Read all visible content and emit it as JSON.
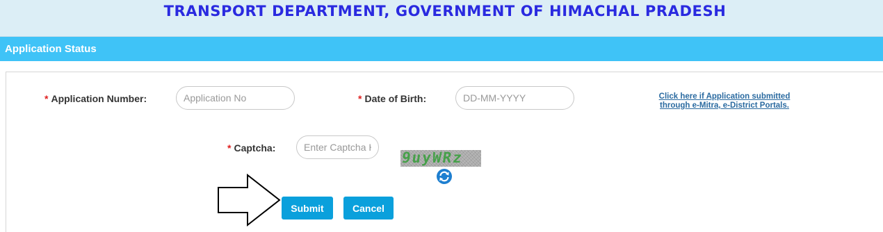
{
  "header": {
    "title": "TRANSPORT DEPARTMENT, GOVERNMENT OF HIMACHAL PRADESH"
  },
  "panel": {
    "title": "Application Status"
  },
  "form": {
    "required_marker": "*",
    "application_number": {
      "label": "Application Number:",
      "placeholder": "Application No",
      "value": ""
    },
    "date_of_birth": {
      "label": "Date of Birth:",
      "placeholder": "DD-MM-YYYY",
      "value": ""
    },
    "captcha": {
      "label": "Captcha:",
      "placeholder": "Enter Captcha Here",
      "value": "",
      "image_text": "9uyWRz"
    },
    "portal_link": {
      "line1": "Click here if Application submitted",
      "line2": "through e-Mitra, e-District Portals."
    }
  },
  "buttons": {
    "submit": "Submit",
    "cancel": "Cancel"
  },
  "icons": {
    "refresh": "refresh-icon",
    "pointer": "arrow-right-icon"
  },
  "colors": {
    "header_bg": "#dceef6",
    "header_text": "#2a2ae0",
    "panel_bar": "#3fc3f7",
    "button": "#0aa0dc",
    "required": "#e02020",
    "link": "#2a6aa0",
    "captcha_text": "#46a04a"
  }
}
